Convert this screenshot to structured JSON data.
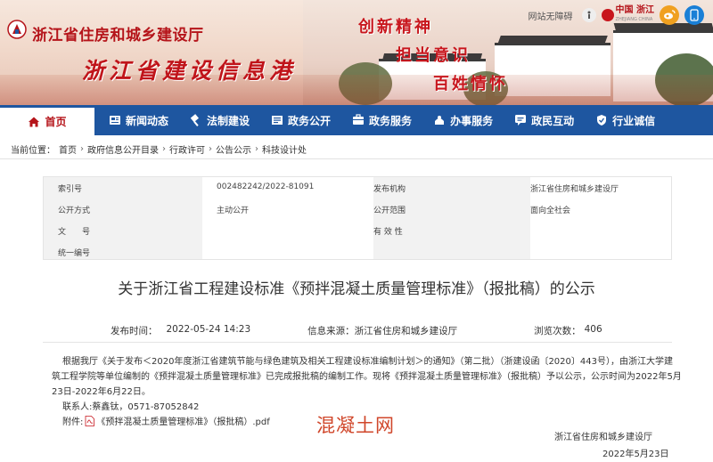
{
  "header": {
    "site_name": "浙江省住房和城乡建设厅",
    "site_subtitle": "浙江省建设信息港",
    "slogans": [
      "创新精神",
      "担当意识",
      "百姓情怀"
    ],
    "no_barrier": "网站无障碍",
    "zj_gov_mark": "中国 浙江",
    "zj_gov_mark_small": "ZHEJIANG CHINA"
  },
  "nav": {
    "items": [
      {
        "label": "首页",
        "icon": "home-icon"
      },
      {
        "label": "新闻动态",
        "icon": "news-icon"
      },
      {
        "label": "法制建设",
        "icon": "law-icon"
      },
      {
        "label": "政务公开",
        "icon": "public-icon"
      },
      {
        "label": "政务服务",
        "icon": "service-icon"
      },
      {
        "label": "办事服务",
        "icon": "handle-icon"
      },
      {
        "label": "政民互动",
        "icon": "interact-icon"
      },
      {
        "label": "行业诚信",
        "icon": "credit-icon"
      }
    ]
  },
  "breadcrumb": {
    "prefix": "当前位置：",
    "items": [
      "首页",
      "政府信息公开目录",
      "行政许可",
      "公告公示",
      "科技设计处"
    ]
  },
  "info": {
    "labels": {
      "index_no": "索引号",
      "publish_org": "发布机构",
      "open_method": "公开方式",
      "open_range": "公开范围",
      "doc_no": "文　　号",
      "validity": "有 效 性",
      "unified_no": "统一编号"
    },
    "values": {
      "index_no": "002482242/2022-81091",
      "publish_org": "浙江省住房和城乡建设厅",
      "open_method": "主动公开",
      "open_range": "面向全社会"
    }
  },
  "article": {
    "title": "关于浙江省工程建设标准《预拌混凝土质量管理标准》（报批稿）的公示",
    "publish_time_label": "发布时间：",
    "publish_time": "2022-05-24 14:23",
    "source_label": "信息来源：",
    "source": "浙江省住房和城乡建设厅",
    "views_label": "浏览次数：",
    "views": "406",
    "body_lines": [
      "根据我厅《关于发布＜2020年度浙江省建筑节能与绿色建筑及相关工程建设标准编制计划＞的通知》（第二批）（浙建设函〔2020〕443号），由浙江大学建",
      "筑工程学院等单位编制的《预拌混凝土质量管理标准》已完成报批稿的编制工作。现将《预拌混凝土质量管理标准》（报批稿）予以公示，公示时间为2022年5月",
      "23日-2022年6月22日。"
    ],
    "contact": "联系人:蔡鑫钛，0571-87052842",
    "attach_label": "附件:",
    "attach_file": "《预拌混凝土质量管理标准》（报批稿）.pdf",
    "watermark": "混凝土网",
    "signer": "浙江省住房和城乡建设厅",
    "sign_date": "2022年5月23日"
  }
}
